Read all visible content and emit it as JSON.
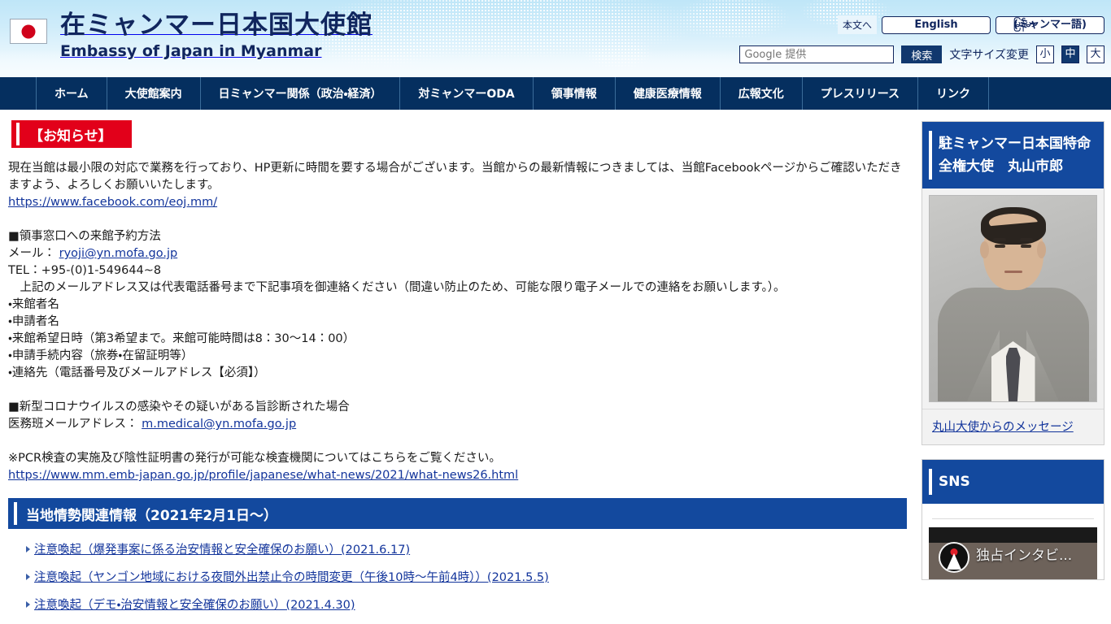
{
  "header": {
    "flag_icon": "japan-flag-icon",
    "title_ja": "在ミャンマー日本国大使館",
    "title_en": "Embassy of Japan in Myanmar",
    "skip_to_content": "本文へ",
    "lang_english": "English",
    "lang_myanmar_burmese": "မြန်မာ",
    "lang_myanmar_label": "(ミャンマー語)",
    "search_placeholder": "Google 提供",
    "search_value": "",
    "search_button": "検索",
    "font_size_label": "文字サイズ変更",
    "font_sizes": [
      {
        "label": "小",
        "active": false
      },
      {
        "label": "中",
        "active": true
      },
      {
        "label": "大",
        "active": false
      }
    ]
  },
  "nav": {
    "items": [
      "ホーム",
      "大使館案内",
      "日ミャンマー関係（政治・経済）",
      "対ミャンマーODA",
      "領事情報",
      "健康医療情報",
      "広報文化",
      "プレスリリース",
      "リンク"
    ]
  },
  "main": {
    "notice_banner": "【お知らせ】",
    "paragraph1": "現在当館は最小限の対応で業務を行っており、HP更新に時間を要する場合がございます。当館からの最新情報につきましては、当館Facebookページからご確認いただきますよう、よろしくお願いいたします。",
    "facebook_url": "https://www.facebook.com/eoj.mm/",
    "consular_heading": "■領事窓口への来館予約方法",
    "mail_label": "メール：",
    "mail_address": "ryoji@yn.mofa.go.jp",
    "tel_line": "TEL：+95-(0)1-549644~8",
    "instruction": "　上記のメールアドレス又は代表電話番号まで下記事項を御連絡ください（間違い防止のため、可能な限り電子メールでの連絡をお願いします。）。",
    "bullets": [
      "・来館者名",
      "・申請者名",
      "・来館希望日時（第3希望まで。来館可能時間は8：30〜14：00）",
      "・申請手続内容（旅券・在留証明等）",
      "・連絡先（電話番号及びメールアドレス【必須】）"
    ],
    "covid_heading": "■新型コロナウイルスの感染やその疑いがある旨診断された場合",
    "medical_label": "医務班メールアドレス：",
    "medical_address": "m.medical@yn.mofa.go.jp",
    "pcr_note": "※PCR検査の実施及び陰性証明書の発行が可能な検査機関についてはこちらをご覧ください。",
    "pcr_url": "https://www.mm.emb-japan.go.jp/profile/japanese/what-news/2021/what-news26.html",
    "section_heading": "当地情勢関連情報（2021年2月1日〜）",
    "links": [
      "注意喚起（爆発事案に係る治安情報と安全確保のお願い）(2021.6.17)",
      "注意喚起（ヤンゴン地域における夜間外出禁止令の時間変更（午後10時〜午前4時））(2021.5.5)",
      "注意喚起（デモ・治安情報と安全確保のお願い）(2021.4.30)"
    ]
  },
  "sidebar": {
    "ambassador_title": "駐ミャンマー日本国特命全権大使　丸山市郎",
    "ambassador_photo": "ambassador-portrait",
    "ambassador_message_link": "丸山大使からのメッセージ",
    "sns_title": "SNS",
    "video_title": "独占インタビ...",
    "video_logo": "japan-embassy-logo-icon"
  },
  "colors": {
    "nav_bg": "#052f5f",
    "section_blue": "#13499e",
    "notice_red": "#e2001a",
    "link_blue": "#12349b",
    "header_blue": "#bfe6f8"
  }
}
